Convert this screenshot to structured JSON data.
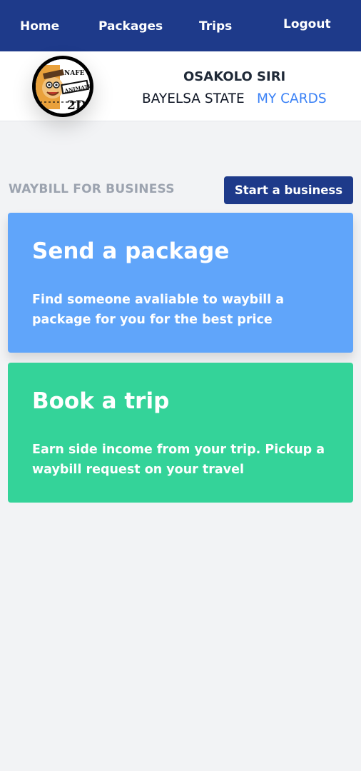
{
  "nav": {
    "items": [
      {
        "label": "Home"
      },
      {
        "label": "Packages"
      },
      {
        "label": "Trips"
      },
      {
        "label": "Logout"
      }
    ],
    "background": "#1e3a8a"
  },
  "profile": {
    "name": "OSAKOLO SIRI",
    "state": "BAYELSA STATE",
    "cards_link": "MY CARDS",
    "avatar_text_top": "NAFE",
    "avatar_text_mid": "ANIMATIO",
    "avatar_text_bottom": "2D"
  },
  "business": {
    "section_title": "WAYBILL FOR BUSINESS",
    "start_button": "Start a business"
  },
  "cards": [
    {
      "title": "Send a package",
      "description": "Find someone avaliable to waybill a package for you for the best price",
      "color": "#60a5fa"
    },
    {
      "title": "Book a trip",
      "description": "Earn side income from your trip. Pickup a waybill request on your travel",
      "color": "#34d399"
    }
  ]
}
